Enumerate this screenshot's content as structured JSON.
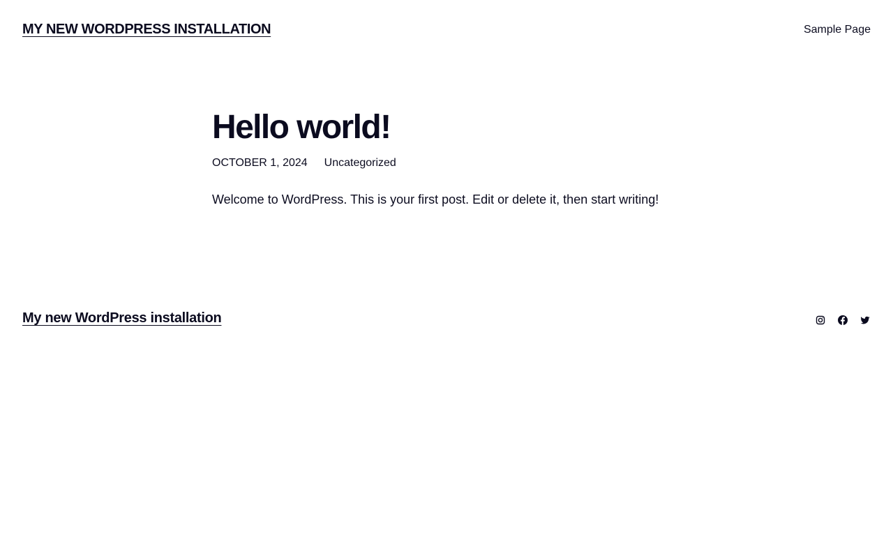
{
  "header": {
    "site_title": "MY NEW WORDPRESS INSTALLATION",
    "nav": [
      "Sample Page"
    ]
  },
  "post": {
    "title": "Hello world!",
    "date": "OCTOBER 1, 2024",
    "category": "Uncategorized",
    "content": "Welcome to WordPress. This is your first post. Edit or delete it, then start writing!"
  },
  "footer": {
    "site_title": "My new WordPress installation",
    "social_icons": [
      "instagram-icon",
      "facebook-icon",
      "twitter-icon"
    ]
  },
  "colors": {
    "text": "#0b0b1f",
    "background": "#ffffff"
  }
}
